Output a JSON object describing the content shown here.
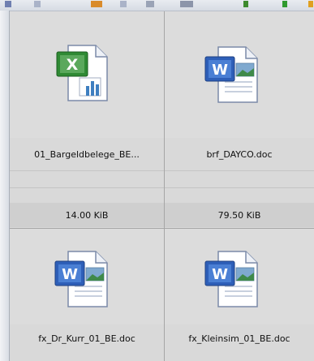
{
  "files": [
    {
      "name": "01_Bargeldbelege_BE...",
      "size": "14.00 KiB",
      "icon": "excel-file-icon",
      "icon_color": "#2f8a34"
    },
    {
      "name": "brf_DAYCO.doc",
      "size": "79.50 KiB",
      "icon": "word-file-icon",
      "icon_color": "#2e5fb8"
    },
    {
      "name": "fx_Dr_Kurr_01_BE.doc",
      "size": "",
      "icon": "word-file-icon",
      "icon_color": "#2e5fb8"
    },
    {
      "name": "fx_Kleinsim_01_BE.doc",
      "size": "",
      "icon": "word-file-icon",
      "icon_color": "#2e5fb8"
    }
  ],
  "colors": {
    "grid_background": "#d9d9d9",
    "thumbnail_background": "#dcdcdc",
    "divider": "#a6a6a6"
  }
}
